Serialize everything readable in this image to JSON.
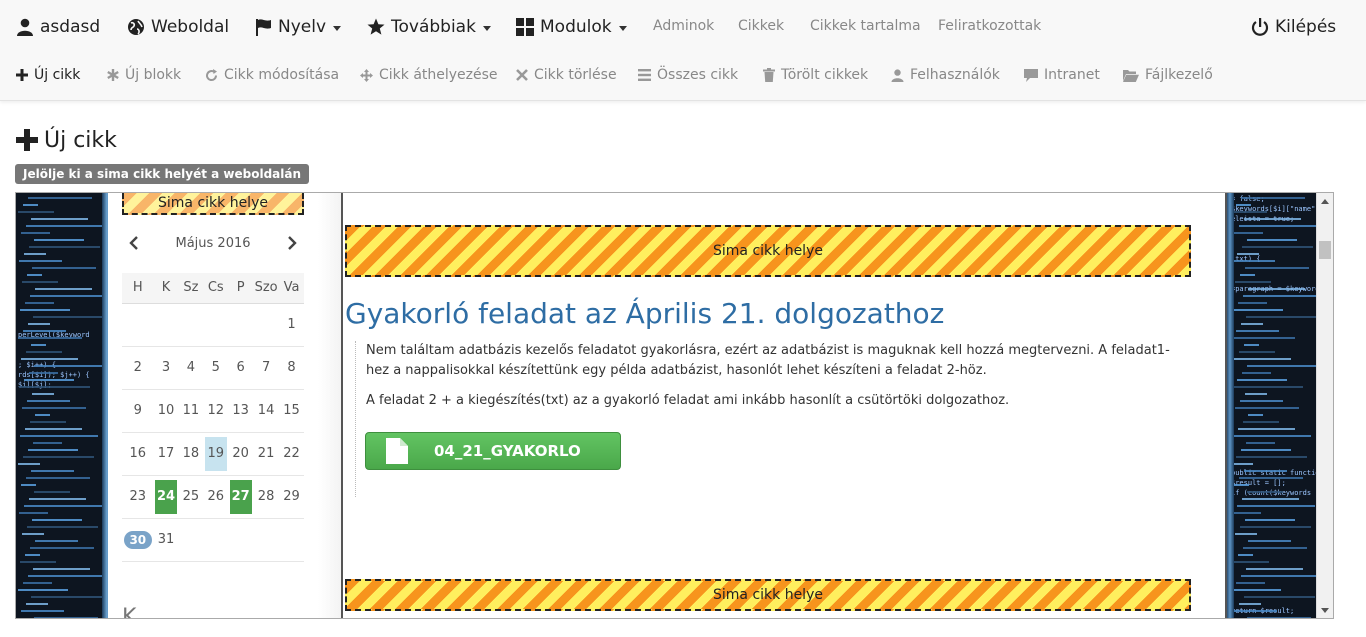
{
  "navbar": {
    "user": "asdasd",
    "website": "Weboldal",
    "language": "Nyelv",
    "more": "Továbbiak",
    "modules": "Modulok",
    "admins": "Adminok",
    "articles": "Cikkek",
    "article_contents": "Cikkek tartalma",
    "subscribers": "Feliratkozottak",
    "logout": "Kilépés"
  },
  "subnav": {
    "new_article": "Új cikk",
    "new_block": "Új blokk",
    "edit_article": "Cikk módosítása",
    "move_article": "Cikk áthelyezése",
    "delete_article": "Cikk törlése",
    "all_articles": "Összes cikk",
    "deleted_articles": "Törölt cikkek",
    "users": "Felhasználók",
    "intranet": "Intranet",
    "file_manager": "Fájlkezelő"
  },
  "page": {
    "title": "Új cikk",
    "hint": "Jelölje ki a sima cikk helyét a weboldalán"
  },
  "preview": {
    "placeholder": "Sima cikk helye",
    "calendar": {
      "month": "Május 2016",
      "weekdays": [
        "H",
        "K",
        "Sz",
        "Cs",
        "P",
        "Szo",
        "Va"
      ],
      "weeks": [
        [
          "",
          "",
          "",
          "",
          "",
          "",
          "1"
        ],
        [
          "2",
          "3",
          "4",
          "5",
          "6",
          "7",
          "8"
        ],
        [
          "9",
          "10",
          "11",
          "12",
          "13",
          "14",
          "15"
        ],
        [
          "16",
          "17",
          "18",
          "19",
          "20",
          "21",
          "22"
        ],
        [
          "23",
          "24",
          "25",
          "26",
          "27",
          "28",
          "29"
        ],
        [
          "30",
          "31",
          "",
          "",
          "",
          "",
          ""
        ]
      ],
      "today": "19",
      "event_days": [
        "24",
        "27"
      ],
      "highlight_day": "30"
    },
    "sidebar_cut_text": "K",
    "article": {
      "title": "Gyakorló feladat az Április 21. dolgozathoz",
      "paragraph1": "Nem találtam adatbázis kezelős feladatot gyakorlásra, ezért az adatbázist is maguknak kell hozzá megtervezni. A feladat1-hez a nappalisokkal készítettünk egy példa adatbázist, hasonlót lehet készíteni a feladat 2-höz.",
      "paragraph2": "A feladat 2 + a kiegészítés(txt) az a gyakorló feladat ami inkább hasonlít a csütörtöki dolgozathoz.",
      "download_label": "04_21_GYAKORLO"
    }
  },
  "colors": {
    "accent": "#2e6da4",
    "success": "#4aa24c",
    "stripe_dark": "#f7941d",
    "stripe_light": "#ffef5e"
  }
}
